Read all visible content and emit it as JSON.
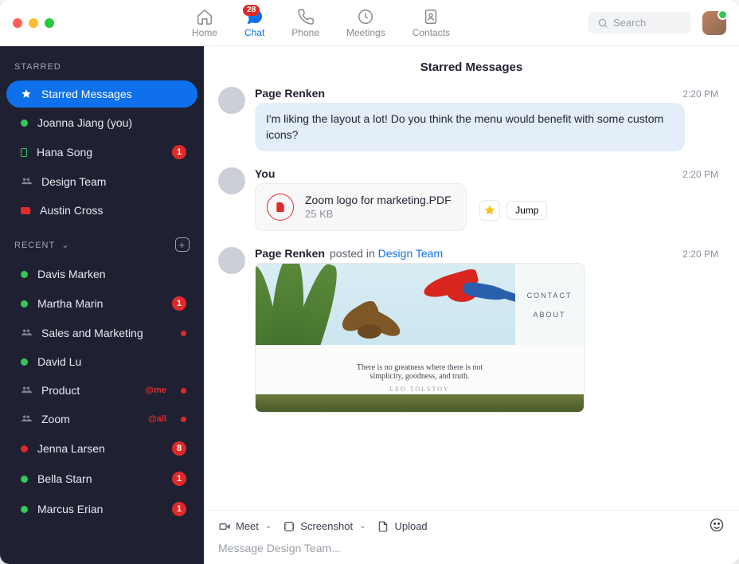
{
  "nav": {
    "home": "Home",
    "chat": "Chat",
    "chat_badge": "28",
    "phone": "Phone",
    "meetings": "Meetings",
    "contacts": "Contacts",
    "search_placeholder": "Search"
  },
  "sidebar": {
    "starred_heading": "STARRED",
    "recent_heading": "RECENT",
    "starred": [
      {
        "label": "Starred Messages"
      },
      {
        "label": "Joanna Jiang (you)"
      },
      {
        "label": "Hana Song",
        "badge": "1"
      },
      {
        "label": "Design Team"
      },
      {
        "label": "Austin Cross"
      }
    ],
    "recent": [
      {
        "label": "Davis Marken"
      },
      {
        "label": "Martha Marin",
        "badge": "1"
      },
      {
        "label": "Sales and Marketing"
      },
      {
        "label": "David Lu"
      },
      {
        "label": "Product",
        "tag": "@me"
      },
      {
        "label": "Zoom",
        "tag": "@all"
      },
      {
        "label": "Jenna Larsen",
        "badge": "8"
      },
      {
        "label": "Bella Starn",
        "badge": "1"
      },
      {
        "label": "Marcus Erian",
        "badge": "1"
      }
    ]
  },
  "main": {
    "title": "Starred Messages",
    "messages": [
      {
        "author": "Page Renken",
        "time": "2:20 PM",
        "text": "I'm liking the layout a lot! Do you think the menu would benefit with some custom icons?"
      },
      {
        "author": "You",
        "time": "2:20 PM",
        "file": {
          "name": "Zoom logo for marketing.PDF",
          "size": "25 KB"
        },
        "jump_label": "Jump"
      },
      {
        "author": "Page Renken",
        "posted_in_prefix": " posted in ",
        "posted_in": "Design Team",
        "time": "2:20 PM",
        "preview": {
          "menu1": "CONTACT",
          "menu2": "ABOUT",
          "quote_line1": "There is no greatness where there is not",
          "quote_line2": "simplicity, goodness, and truth.",
          "quote_author": "LEO TOLSTOY"
        }
      }
    ]
  },
  "composer": {
    "meet": "Meet",
    "screenshot": "Screenshot",
    "upload": "Upload",
    "placeholder": "Message Design Team..."
  }
}
